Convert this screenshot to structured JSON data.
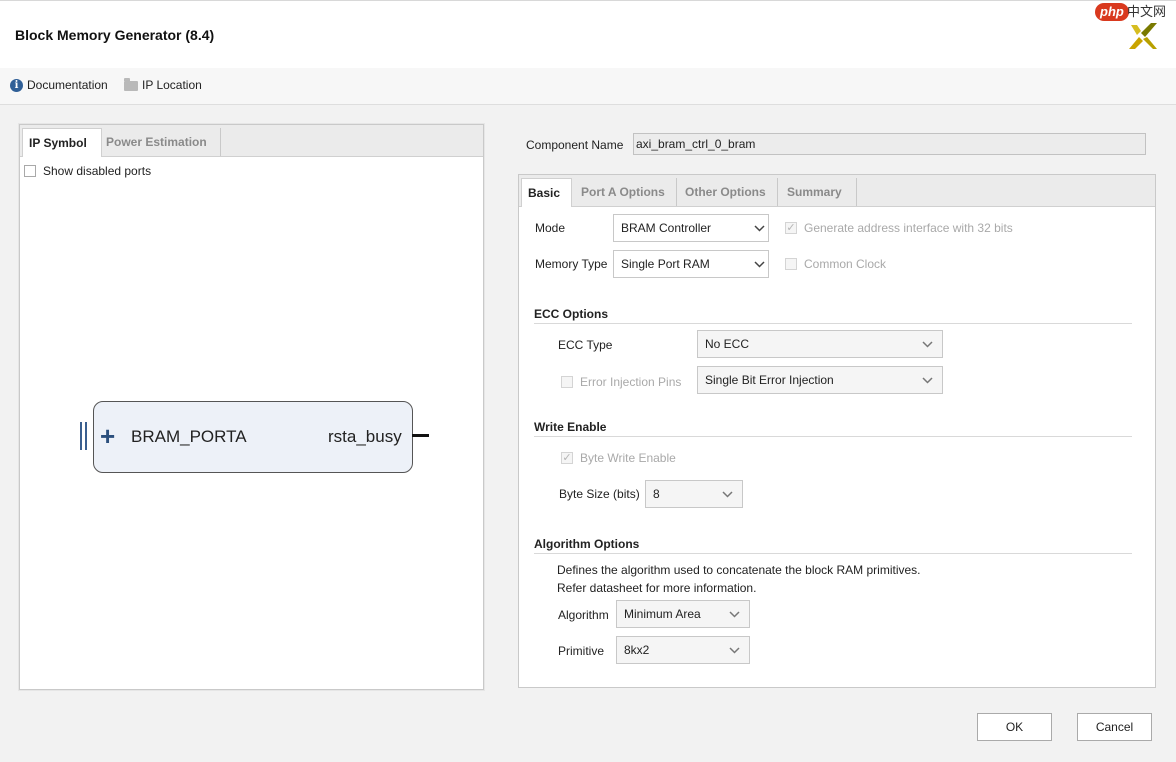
{
  "window": {
    "title": "Block Memory Generator (8.4)"
  },
  "watermark": {
    "php": "php",
    "cn": "中文网"
  },
  "toolbar": {
    "documentation": "Documentation",
    "ip_location": "IP Location"
  },
  "left_panel": {
    "tabs": [
      {
        "label": "IP Symbol",
        "active": true
      },
      {
        "label": "Power Estimation",
        "active": false
      }
    ],
    "show_disabled_ports": {
      "label": "Show disabled ports",
      "checked": false
    },
    "symbol": {
      "port_left": "BRAM_PORTA",
      "port_right": "rsta_busy"
    }
  },
  "component_name": {
    "label": "Component Name",
    "value": "axi_bram_ctrl_0_bram"
  },
  "right_tabs": [
    {
      "label": "Basic",
      "active": true
    },
    {
      "label": "Port A Options",
      "active": false
    },
    {
      "label": "Other Options",
      "active": false
    },
    {
      "label": "Summary",
      "active": false
    }
  ],
  "basic": {
    "mode": {
      "label": "Mode",
      "value": "BRAM Controller"
    },
    "memory_type": {
      "label": "Memory Type",
      "value": "Single Port RAM"
    },
    "gen_addr_32": {
      "label": "Generate address interface with 32 bits",
      "checked": true,
      "disabled": true
    },
    "common_clock": {
      "label": "Common Clock",
      "checked": false,
      "disabled": true
    },
    "ecc": {
      "title": "ECC Options",
      "ecc_type": {
        "label": "ECC Type",
        "value": "No ECC"
      },
      "error_injection_pins": {
        "label": "Error Injection Pins",
        "checked": false,
        "disabled": true,
        "value": "Single Bit Error Injection"
      }
    },
    "write_enable": {
      "title": "Write Enable",
      "byte_write_enable": {
        "label": "Byte Write Enable",
        "checked": true,
        "disabled": true
      },
      "byte_size": {
        "label": "Byte Size (bits)",
        "value": "8"
      }
    },
    "algorithm": {
      "title": "Algorithm Options",
      "desc1": "Defines the algorithm used to concatenate the block RAM primitives.",
      "desc2": "Refer datasheet for more information.",
      "algorithm": {
        "label": "Algorithm",
        "value": "Minimum Area"
      },
      "primitive": {
        "label": "Primitive",
        "value": "8kx2"
      }
    }
  },
  "buttons": {
    "ok": "OK",
    "cancel": "Cancel"
  },
  "colors": {
    "accent": "#2f5f97",
    "symbol_fill": "#edf1f8"
  }
}
